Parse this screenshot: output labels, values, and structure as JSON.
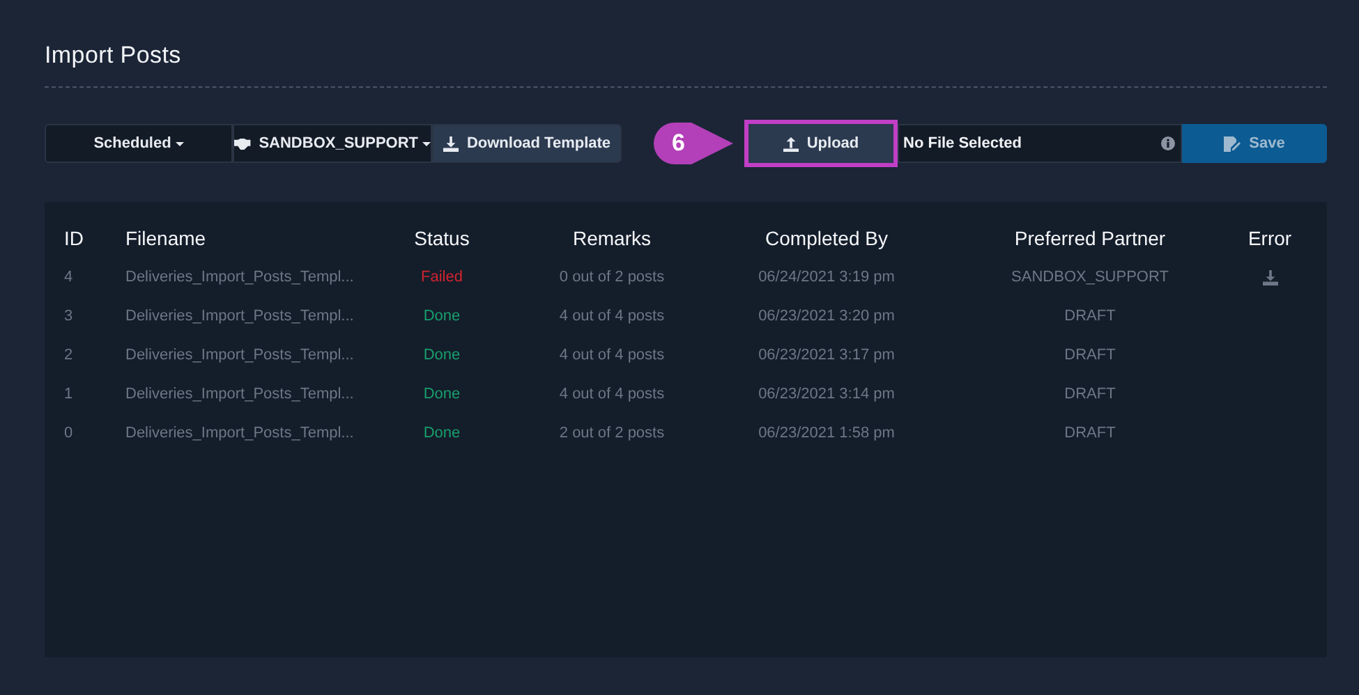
{
  "page": {
    "title": "Import Posts"
  },
  "toolbar": {
    "status_dropdown": "Scheduled",
    "partner_dropdown": "SANDBOX_SUPPORT",
    "download_button": "Download Template",
    "step_badge": "6",
    "upload_button": {
      "label": "Upload",
      "highlighted": true
    },
    "file_field": "No File Selected",
    "save_button": "Save"
  },
  "table": {
    "columns": [
      "ID",
      "Filename",
      "Status",
      "Remarks",
      "Completed By",
      "Preferred Partner",
      "Error"
    ],
    "rows": [
      {
        "id": "4",
        "filename": "Deliveries_Import_Posts_Templ...",
        "status": {
          "kind": "failed",
          "text": "Failed"
        },
        "remarks": "0 out of 2 posts",
        "completed_by": "06/24/2021 3:19 pm",
        "partner": "SANDBOX_SUPPORT",
        "error_file": true
      },
      {
        "id": "3",
        "filename": "Deliveries_Import_Posts_Templ...",
        "status": {
          "kind": "done",
          "text": "Done"
        },
        "remarks": "4 out of 4 posts",
        "completed_by": "06/23/2021 3:20 pm",
        "partner": "DRAFT",
        "error_file": false
      },
      {
        "id": "2",
        "filename": "Deliveries_Import_Posts_Templ...",
        "status": {
          "kind": "done",
          "text": "Done"
        },
        "remarks": "4 out of 4 posts",
        "completed_by": "06/23/2021 3:17 pm",
        "partner": "DRAFT",
        "error_file": false
      },
      {
        "id": "1",
        "filename": "Deliveries_Import_Posts_Templ...",
        "status": {
          "kind": "done",
          "text": "Done"
        },
        "remarks": "4 out of 4 posts",
        "completed_by": "06/23/2021 3:14 pm",
        "partner": "DRAFT",
        "error_file": false
      },
      {
        "id": "0",
        "filename": "Deliveries_Import_Posts_Templ...",
        "status": {
          "kind": "done",
          "text": "Done"
        },
        "remarks": "2 out of 2 posts",
        "completed_by": "06/23/2021 1:58 pm",
        "partner": "DRAFT",
        "error_file": false
      }
    ]
  }
}
